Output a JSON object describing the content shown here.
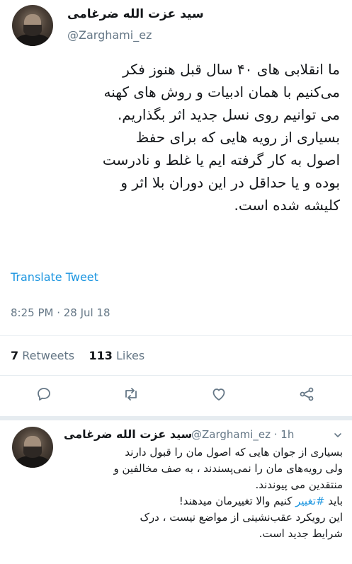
{
  "main_tweet": {
    "display_name": "سید عزت الله ضرغامی",
    "handle": "@Zarghami_ez",
    "lines": [
      "ما انقلابی های ۴۰ سال قبل هنوز فکر",
      "می‌کنیم با همان ادبیات و روش های کهنه",
      "می توانیم روی نسل جدید اثر بگذاریم.",
      "بسیاری از رویه هایی که برای حفظ",
      "اصول به کار گرفته ایم یا غلط و نادرست",
      "بوده و یا حداقل در این دوران بلا اثر و",
      "کلیشه شده است."
    ],
    "translate_label": "Translate Tweet",
    "timestamp": "8:25 PM · 28 Jul 18",
    "retweets_count": "7",
    "retweets_label": "Retweets",
    "likes_count": "113",
    "likes_label": "Likes"
  },
  "actions": {
    "reply_icon": "reply-icon",
    "retweet_icon": "retweet-icon",
    "like_icon": "heart-icon",
    "share_icon": "share-icon"
  },
  "reply_tweet": {
    "display_name": "سید عزت الله ضرغامی",
    "handle_time": "@Zarghami_ez · 1h",
    "line1": "بسیاری از جوان هایی که اصول مان را قبول دارند",
    "line2": "ولی رویه‌های مان را نمی‌پسندند ، به صف مخالفین و",
    "line3": "منتقدین می پیوندند.",
    "line4_pre": "باید ",
    "line4_hashtag": "#تغییر",
    "line4_post": " کنیم والا تغییرمان میدهند!",
    "line5": "این رویکرد عقب‌نشینی از مواضع نیست ، درک",
    "line6": "شرایط جدید است."
  },
  "colors": {
    "link": "#1b95e0",
    "secondary_text": "#657786",
    "divider": "#e6ecf0"
  }
}
